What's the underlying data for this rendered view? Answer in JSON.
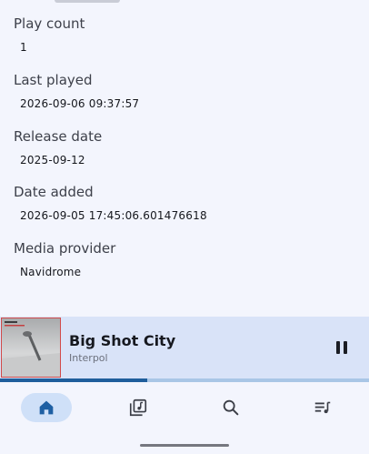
{
  "details": [
    {
      "label": "Play count",
      "value": "1"
    },
    {
      "label": "Last played",
      "value": "2026-09-06 09:37:57"
    },
    {
      "label": "Release date",
      "value": "2025-09-12"
    },
    {
      "label": "Date added",
      "value": "2026-09-05 17:45:06.601476618"
    },
    {
      "label": "Media provider",
      "value": "Navidrome"
    }
  ],
  "player": {
    "title": "Big Shot City",
    "artist": "Interpol",
    "progress_percent": 40,
    "state_icon": "pause-icon"
  },
  "navigation": {
    "items": [
      {
        "icon": "home-icon",
        "active": true
      },
      {
        "icon": "library-icon",
        "active": false
      },
      {
        "icon": "search-icon",
        "active": false
      },
      {
        "icon": "queue-icon",
        "active": false
      }
    ]
  },
  "colors": {
    "background": "#f3f5fd",
    "player_background": "#d9e3f8",
    "accent": "#1f5e9c",
    "active_nav": "#cfe0f8"
  }
}
